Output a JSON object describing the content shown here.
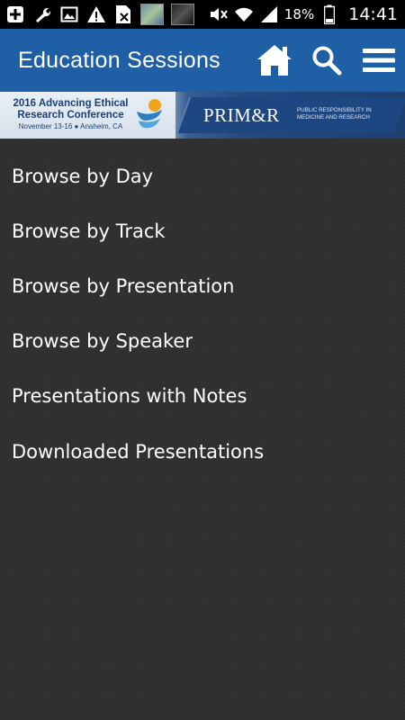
{
  "status_bar": {
    "battery_percent": "18%",
    "time": "14:41",
    "icons": [
      "add-icon",
      "wrench-icon",
      "image-icon",
      "warning-icon",
      "sim-card-icon",
      "app-thumbnail-icon",
      "app-thumbnail-icon",
      "mute-icon",
      "wifi-icon",
      "signal-icon",
      "battery-icon"
    ]
  },
  "app_bar": {
    "title": "Education Sessions",
    "actions": [
      "home-icon",
      "search-icon",
      "menu-icon"
    ],
    "color": "#1f5fa6"
  },
  "banner": {
    "conference_line1": "2016 Advancing Ethical",
    "conference_line2": "Research Conference",
    "conference_dates": "November 13-16 ● Anaheim, CA",
    "org_name": "PRIM&R",
    "org_tagline": "PUBLIC RESPONSIBILITY IN MEDICINE AND RESEARCH"
  },
  "menu": {
    "items": [
      {
        "label": "Browse by Day"
      },
      {
        "label": "Browse by Track"
      },
      {
        "label": "Browse by Presentation"
      },
      {
        "label": "Browse by Speaker"
      },
      {
        "label": "Presentations with Notes"
      },
      {
        "label": "Downloaded Presentations"
      }
    ]
  }
}
